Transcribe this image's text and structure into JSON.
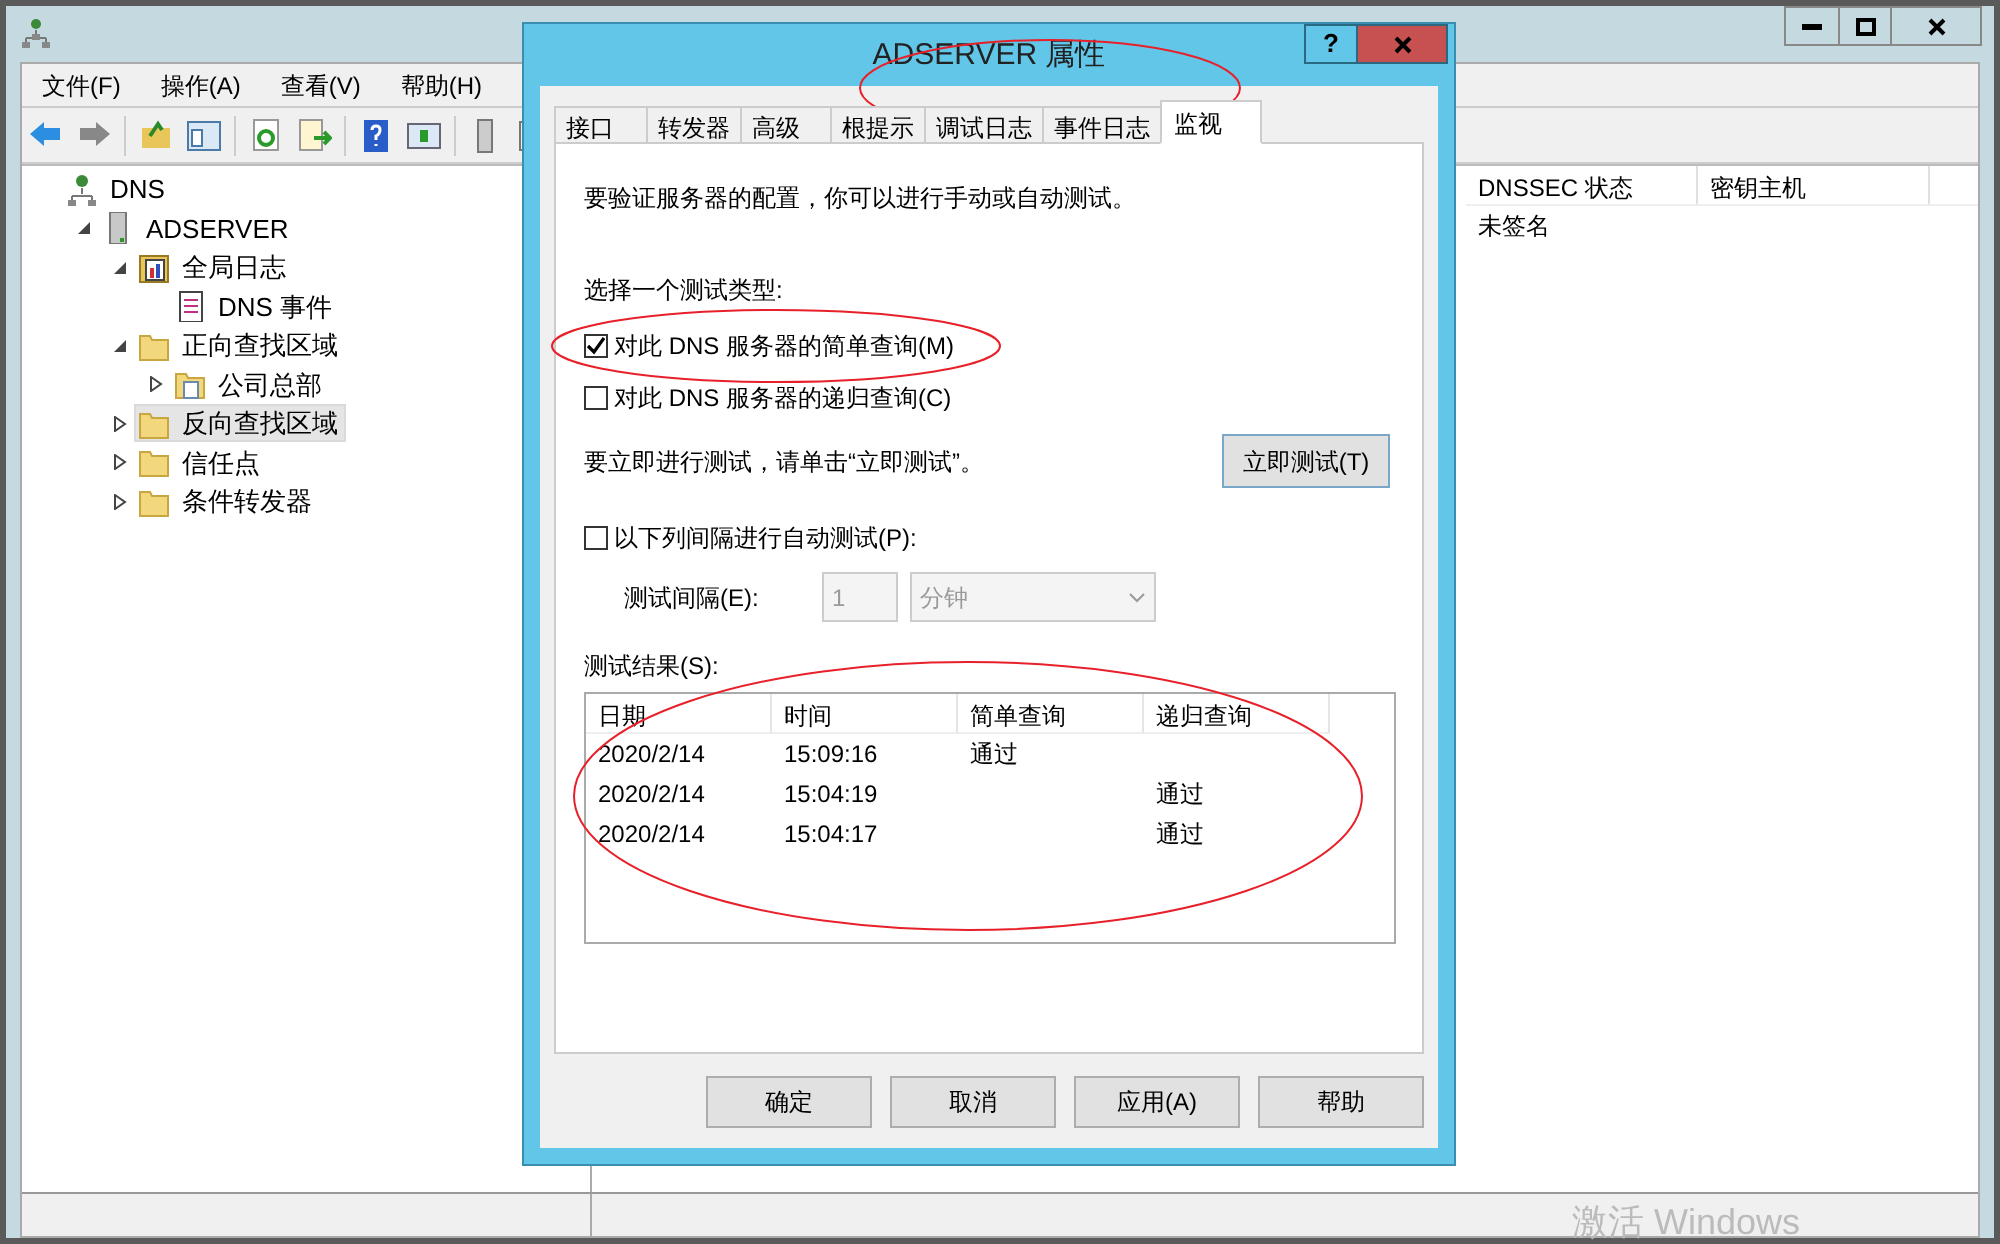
{
  "main_window": {
    "menu": [
      "文件(F)",
      "操作(A)",
      "查看(V)",
      "帮助(H)"
    ],
    "tree": [
      {
        "label": "DNS",
        "kind": "dns",
        "selected": false,
        "children": [
          {
            "label": "ADSERVER",
            "kind": "server",
            "expanded": true,
            "selected": false,
            "children": [
              {
                "label": "全局日志",
                "kind": "log",
                "expanded": true,
                "selected": false,
                "children": [
                  {
                    "label": "DNS 事件",
                    "kind": "events",
                    "selected": false
                  }
                ]
              },
              {
                "label": "正向查找区域",
                "kind": "folder",
                "expanded": true,
                "selected": false,
                "children": [
                  {
                    "label": "公司总部",
                    "kind": "zone",
                    "expanded": false,
                    "selected": false
                  }
                ]
              },
              {
                "label": "反向查找区域",
                "kind": "folder",
                "expanded": false,
                "selected": true
              },
              {
                "label": "信任点",
                "kind": "folder",
                "expanded": false,
                "selected": false
              },
              {
                "label": "条件转发器",
                "kind": "folder",
                "expanded": false,
                "selected": false
              }
            ]
          }
        ]
      }
    ],
    "list": {
      "columns": [
        "DNSSEC 状态",
        "密钥主机"
      ],
      "rows": [
        [
          "未签名"
        ]
      ]
    },
    "activation_notice": "激活 Windows"
  },
  "dialog": {
    "title": "ADSERVER 属性",
    "help_button": "?",
    "tabs": [
      {
        "label": "接口",
        "selected": false
      },
      {
        "label": "转发器",
        "selected": false
      },
      {
        "label": "高级",
        "selected": false
      },
      {
        "label": "根提示",
        "selected": false
      },
      {
        "label": "调试日志",
        "selected": false
      },
      {
        "label": "事件日志",
        "selected": false
      },
      {
        "label": "监视",
        "selected": true
      }
    ],
    "intro": "要验证服务器的配置，你可以进行手动或自动测试。",
    "test_type_label": "选择一个测试类型:",
    "test_types": [
      {
        "label": "对此 DNS 服务器的简单查询(M)",
        "checked": true
      },
      {
        "label": "对此 DNS 服务器的递归查询(C)",
        "checked": false
      }
    ],
    "instruction": "要立即进行测试，请单击“立即测试”。",
    "test_now_button": "立即测试(T)",
    "auto_test": {
      "label": "以下列间隔进行自动测试(P):",
      "checked": false
    },
    "interval": {
      "label": "测试间隔(E):",
      "value": "1",
      "unit": "分钟",
      "disabled": true
    },
    "results": {
      "label": "测试结果(S):",
      "columns": [
        "日期",
        "时间",
        "简单查询",
        "递归查询"
      ],
      "rows": [
        {
          "date": "2020/2/14",
          "time": "15:09:16",
          "simple": "通过"
        },
        {
          "date": "2020/2/14",
          "time": "15:04:19",
          "recursive": "通过"
        },
        {
          "date": "2020/2/14",
          "time": "15:04:17",
          "recursive": "通过"
        }
      ]
    },
    "buttons": [
      "确定",
      "取消",
      "应用(A)",
      "帮助"
    ]
  }
}
